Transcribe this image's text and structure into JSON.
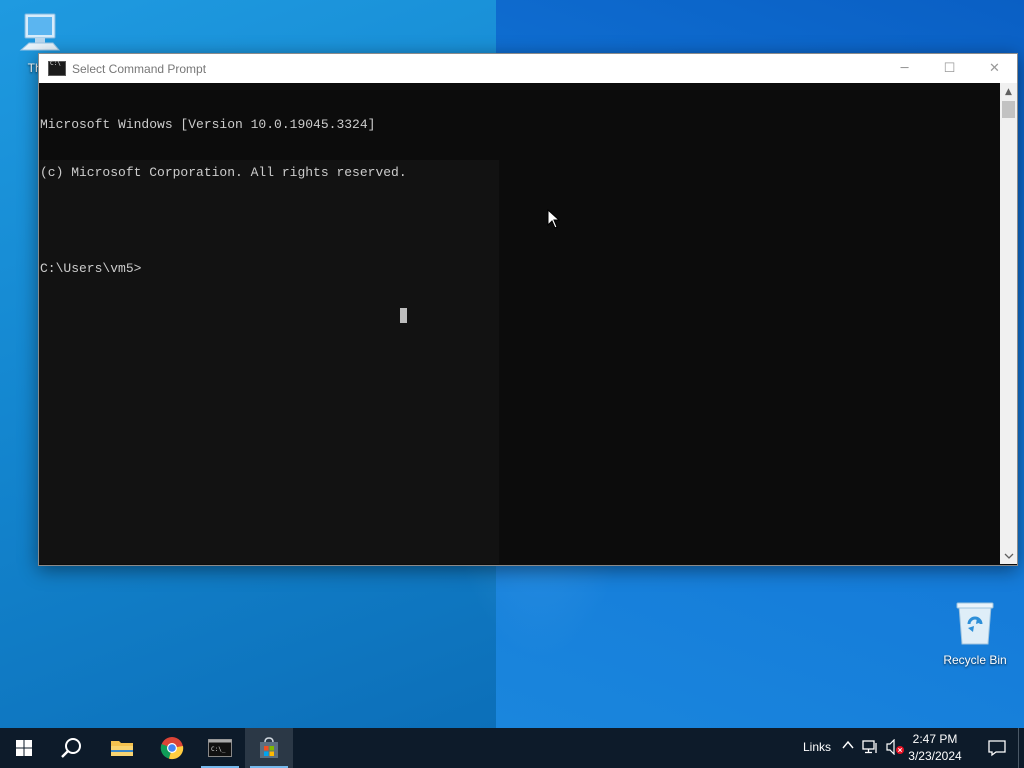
{
  "desktop": {
    "icons": [
      {
        "label": "This PC",
        "visible_label": "This",
        "icon": "computer-icon"
      },
      {
        "label": "Recycle Bin",
        "icon": "recycle-bin-icon"
      }
    ]
  },
  "window": {
    "title": "Select Command Prompt",
    "controls": {
      "minimize": "─",
      "maximize": "☐",
      "close": "✕"
    },
    "console_lines": [
      "Microsoft Windows [Version 10.0.19045.3324]",
      "(c) Microsoft Corporation. All rights reserved.",
      "",
      "C:\\Users\\vm5>"
    ]
  },
  "taskbar": {
    "apps": [
      {
        "name": "Start",
        "icon": "windows-logo-icon"
      },
      {
        "name": "Search",
        "icon": "search-icon"
      },
      {
        "name": "File Explorer",
        "icon": "folder-icon"
      },
      {
        "name": "Google Chrome",
        "icon": "chrome-icon"
      },
      {
        "name": "Command Prompt",
        "icon": "cmd-icon",
        "running": true
      },
      {
        "name": "Microsoft Store",
        "icon": "store-icon",
        "active": true
      }
    ],
    "tray": {
      "links_label": "Links",
      "time": "2:47 PM",
      "date": "3/23/2024"
    }
  },
  "colors": {
    "console_bg": "#0c0c0c",
    "console_text": "#cccccc",
    "taskbar_bg": "#0d1b2a",
    "wallpaper": "#1a8bd6"
  }
}
